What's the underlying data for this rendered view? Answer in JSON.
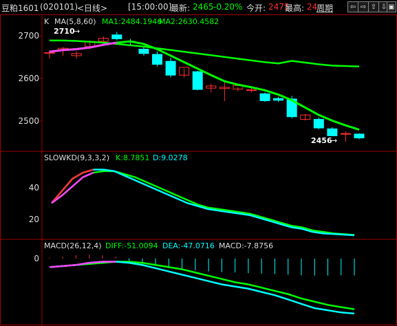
{
  "header": {
    "symbol": "豆粕1601",
    "code": "(020101)",
    "period": "<日线>",
    "time": "[15:00:00]",
    "latest_label": "最新:",
    "latest_value": "2465",
    "change": "-0.20%",
    "open_label": "今开:",
    "open_value": "2475",
    "high_label": "最高:",
    "high_value": "24",
    "period_button": "周期",
    "nav_buttons": [
      "⇦",
      "⇨",
      "⇧",
      "⇩",
      "▣"
    ]
  },
  "price_panel": {
    "legend_k": "K",
    "legend_ma": "MA(5,8,60)",
    "ma1": "MA1:2484.1946",
    "ma2": "MA2:2630.4582",
    "high_marker": "2710",
    "low_marker": "2456",
    "axis_ticks": [
      "2700",
      "2600",
      "2500"
    ]
  },
  "kd_panel": {
    "legend": "SLOWKD(9,3,3,2)",
    "k_value": "K:8.7851",
    "d_value": "D:9.0278",
    "axis_ticks": [
      "40",
      "20"
    ]
  },
  "macd_panel": {
    "legend": "MACD(26,12,4)",
    "diff_value": "DIFF:-51.0094",
    "dea_value": "DEA:-47.0716",
    "macd_value": "MACD:-7.8756",
    "axis_ticks": [
      "0"
    ]
  },
  "colors": {
    "up": "#ff3030",
    "down": "#00ffff",
    "ma1": "#00ff00",
    "ma_pink": "#ff40ff",
    "k_line": "#00ffff",
    "d_line": "#00ff00",
    "grid": "#a00000",
    "header_red": "#ff3030",
    "header_green": "#00ff00"
  },
  "chart_data": [
    {
      "type": "candlestick",
      "title": "",
      "ylim": [
        2450,
        2720
      ],
      "ticks": [
        2700,
        2600,
        2500
      ],
      "candles": [
        {
          "o": 2660,
          "h": 2668,
          "l": 2648,
          "c": 2662
        },
        {
          "o": 2667,
          "h": 2675,
          "l": 2655,
          "c": 2672
        },
        {
          "o": 2655,
          "h": 2665,
          "l": 2648,
          "c": 2660
        },
        {
          "o": 2676,
          "h": 2690,
          "l": 2670,
          "c": 2688
        },
        {
          "o": 2688,
          "h": 2700,
          "l": 2682,
          "c": 2695
        },
        {
          "o": 2703,
          "h": 2710,
          "l": 2690,
          "c": 2694
        },
        {
          "o": 2688,
          "h": 2694,
          "l": 2680,
          "c": 2687
        },
        {
          "o": 2670,
          "h": 2676,
          "l": 2655,
          "c": 2660
        },
        {
          "o": 2658,
          "h": 2665,
          "l": 2630,
          "c": 2635
        },
        {
          "o": 2642,
          "h": 2650,
          "l": 2605,
          "c": 2610
        },
        {
          "o": 2610,
          "h": 2625,
          "l": 2605,
          "c": 2628
        },
        {
          "o": 2618,
          "h": 2620,
          "l": 2575,
          "c": 2577
        },
        {
          "o": 2580,
          "h": 2590,
          "l": 2570,
          "c": 2585
        },
        {
          "o": 2579,
          "h": 2595,
          "l": 2550,
          "c": 2582
        },
        {
          "o": 2578,
          "h": 2582,
          "l": 2572,
          "c": 2586
        },
        {
          "o": 2576,
          "h": 2582,
          "l": 2570,
          "c": 2576
        },
        {
          "o": 2567,
          "h": 2570,
          "l": 2548,
          "c": 2551
        },
        {
          "o": 2556,
          "h": 2560,
          "l": 2548,
          "c": 2552
        },
        {
          "o": 2555,
          "h": 2562,
          "l": 2510,
          "c": 2514
        },
        {
          "o": 2508,
          "h": 2520,
          "l": 2505,
          "c": 2518
        },
        {
          "o": 2508,
          "h": 2512,
          "l": 2485,
          "c": 2488
        },
        {
          "o": 2486,
          "h": 2490,
          "l": 2470,
          "c": 2470
        },
        {
          "o": 2475,
          "h": 2480,
          "l": 2456,
          "c": 2475
        },
        {
          "o": 2474,
          "h": 2476,
          "l": 2462,
          "c": 2465
        }
      ],
      "series": [
        {
          "name": "MA1",
          "values": [
            2664,
            2668,
            2670,
            2674,
            2680,
            2685,
            2688,
            2682,
            2670,
            2655,
            2640,
            2625,
            2610,
            2596,
            2588,
            2582,
            2575,
            2565,
            2552,
            2535,
            2518,
            2505,
            2494,
            2484
          ]
        },
        {
          "name": "MA2",
          "values": [
            2690,
            2690,
            2689,
            2687,
            2685,
            2682,
            2679,
            2676,
            2672,
            2668,
            2664,
            2660,
            2656,
            2652,
            2648,
            2644,
            2640,
            2637,
            2643,
            2639,
            2635,
            2632,
            2631,
            2630
          ]
        }
      ]
    },
    {
      "type": "line",
      "title": "",
      "ylim": [
        7,
        55
      ],
      "ticks": [
        40,
        20
      ],
      "series": [
        {
          "name": "K",
          "values": [
            30,
            38,
            46,
            50,
            52,
            52,
            51,
            48,
            45,
            42,
            39,
            36,
            33,
            30,
            28,
            26,
            25,
            24,
            23,
            22,
            20,
            18,
            16,
            14,
            13,
            11,
            10,
            9.6,
            9.2,
            8.8
          ]
        },
        {
          "name": "D",
          "values": [
            30,
            35,
            41,
            47,
            50,
            51,
            51,
            49,
            47,
            44,
            41,
            38,
            35,
            32,
            29,
            27,
            26,
            25,
            24,
            23,
            21,
            19,
            17,
            15,
            14,
            12,
            11,
            10,
            9.5,
            9.0
          ]
        }
      ]
    },
    {
      "type": "bar",
      "title": "",
      "ylim": [
        -60,
        5
      ],
      "ticks": [
        0
      ],
      "series": [
        {
          "name": "DIFF",
          "values": [
            -8,
            -7,
            -6,
            -4,
            -3,
            -3,
            -4,
            -6,
            -9,
            -12,
            -15,
            -18,
            -21,
            -24,
            -26,
            -28,
            -31,
            -34,
            -38,
            -42,
            -46,
            -48,
            -50,
            -51
          ]
        },
        {
          "name": "DEA",
          "values": [
            -8,
            -7,
            -6,
            -5,
            -4,
            -3,
            -3,
            -4,
            -6,
            -8,
            -10,
            -13,
            -16,
            -19,
            -22,
            -24,
            -27,
            -30,
            -33,
            -37,
            -40,
            -43,
            -45,
            -47
          ]
        },
        {
          "name": "MACD",
          "values": [
            0.4,
            0.8,
            1.5,
            1.8,
            1.5,
            0.8,
            -1,
            -2.5,
            -3.5,
            -4.5,
            -5,
            -5.5,
            -6,
            -6.3,
            -6.5,
            -6.8,
            -7,
            -7.2,
            -7.5,
            -7.8,
            -7.9,
            -7.9,
            -7.8,
            -7.9
          ]
        }
      ]
    }
  ]
}
